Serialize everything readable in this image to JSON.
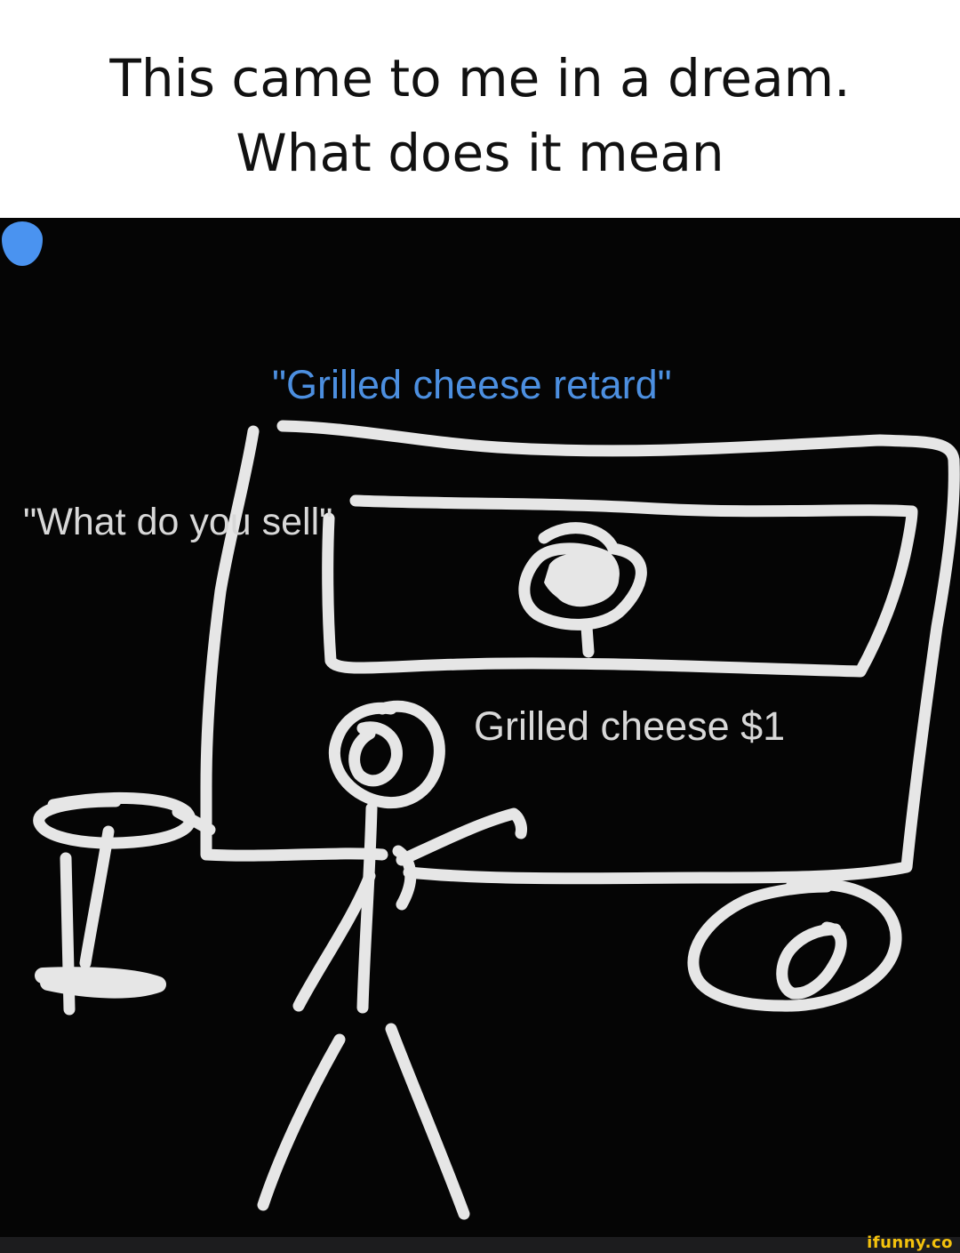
{
  "caption": {
    "line1": "This came to me in a dream.",
    "line2": "What does it mean"
  },
  "drawing": {
    "top_quote": "\"Grilled cheese retard\"",
    "customer_quote": "\"What do you sell\"",
    "price_sign": "Grilled cheese $1",
    "stroke_color": "#e6e6e6",
    "quote_color": "#4c8fe0",
    "background": "#050505",
    "dot_color": "#4a93f0"
  },
  "footer": {
    "watermark": "ifunny.co"
  }
}
